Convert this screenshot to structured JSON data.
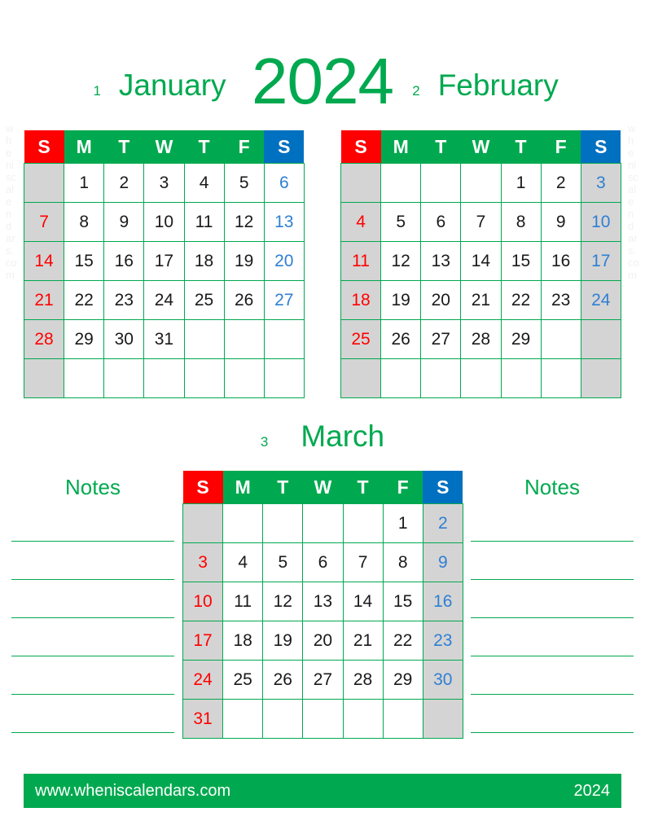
{
  "page": {
    "year_title": "2024",
    "watermark": "wheniscalendars.com"
  },
  "weekday_headers": [
    "S",
    "M",
    "T",
    "W",
    "T",
    "F",
    "S"
  ],
  "notes": {
    "left_title": "Notes",
    "right_title": "Notes",
    "line_count": 6
  },
  "footer": {
    "site": "www.wheniscalendars.com",
    "year": "2024"
  },
  "colors": {
    "green": "#00a94f",
    "red": "#ff0000",
    "blue": "#0070c0",
    "gray": "#d4d4d4",
    "sunday_text": "#ff0000",
    "saturday_text": "#2e7fd4",
    "weekday_text": "#1a1a1a"
  },
  "months": [
    {
      "number": "1",
      "name": "January",
      "shade_sunday": true,
      "shade_saturday": false,
      "weeks": [
        [
          "",
          "1",
          "2",
          "3",
          "4",
          "5",
          "6"
        ],
        [
          "7",
          "8",
          "9",
          "10",
          "11",
          "12",
          "13"
        ],
        [
          "14",
          "15",
          "16",
          "17",
          "18",
          "19",
          "20"
        ],
        [
          "21",
          "22",
          "23",
          "24",
          "25",
          "26",
          "27"
        ],
        [
          "28",
          "29",
          "30",
          "31",
          "",
          "",
          ""
        ],
        [
          "",
          "",
          "",
          "",
          "",
          "",
          ""
        ]
      ]
    },
    {
      "number": "2",
      "name": "February",
      "shade_sunday": true,
      "shade_saturday": true,
      "weeks": [
        [
          "",
          "",
          "",
          "",
          "1",
          "2",
          "3"
        ],
        [
          "4",
          "5",
          "6",
          "7",
          "8",
          "9",
          "10"
        ],
        [
          "11",
          "12",
          "13",
          "14",
          "15",
          "16",
          "17"
        ],
        [
          "18",
          "19",
          "20",
          "21",
          "22",
          "23",
          "24"
        ],
        [
          "25",
          "26",
          "27",
          "28",
          "29",
          "",
          ""
        ],
        [
          "",
          "",
          "",
          "",
          "",
          "",
          ""
        ]
      ]
    },
    {
      "number": "3",
      "name": "March",
      "shade_sunday": true,
      "shade_saturday": true,
      "weeks": [
        [
          "",
          "",
          "",
          "",
          "",
          "1",
          "2"
        ],
        [
          "3",
          "4",
          "5",
          "6",
          "7",
          "8",
          "9"
        ],
        [
          "10",
          "11",
          "12",
          "13",
          "14",
          "15",
          "16"
        ],
        [
          "17",
          "18",
          "19",
          "20",
          "21",
          "22",
          "23"
        ],
        [
          "24",
          "25",
          "26",
          "27",
          "28",
          "29",
          "30"
        ],
        [
          "31",
          "",
          "",
          "",
          "",
          "",
          ""
        ]
      ]
    }
  ]
}
